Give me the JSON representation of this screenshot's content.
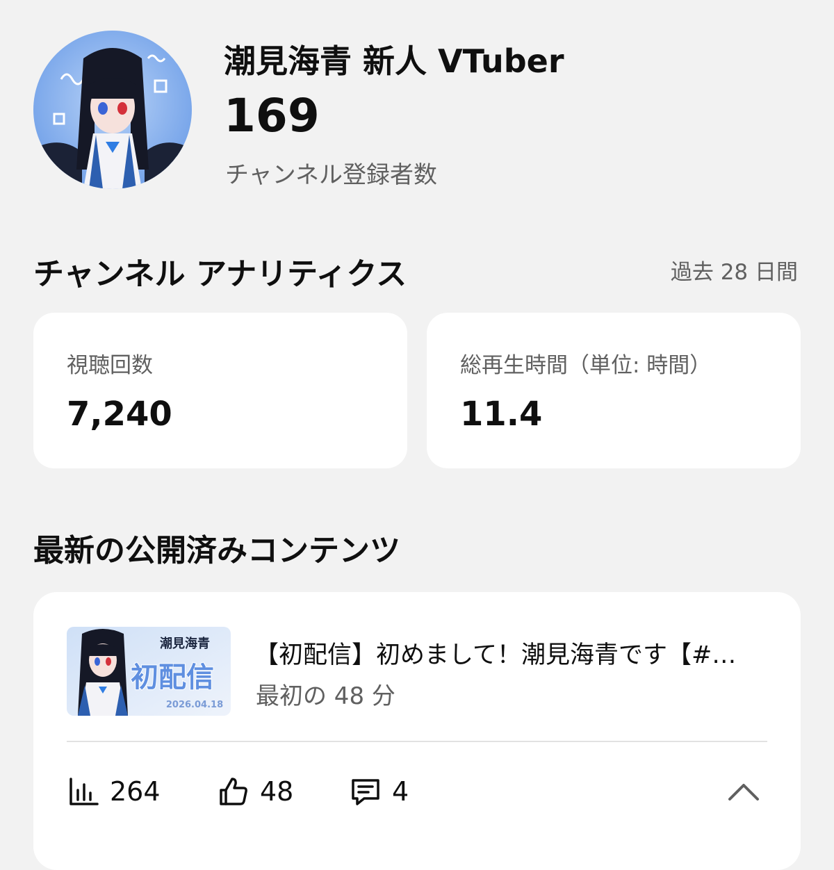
{
  "channel": {
    "name": "潮見海青 新人 VTuber",
    "subscriber_count": "169",
    "subscriber_label": "チャンネル登録者数"
  },
  "analytics": {
    "title": "チャンネル アナリティクス",
    "period": "過去 28 日間",
    "metrics": [
      {
        "label": "視聴回数",
        "value": "7,240"
      },
      {
        "label": "総再生時間（単位: 時間）",
        "value": "11.4"
      }
    ]
  },
  "latest": {
    "title": "最新の公開済みコンテンツ",
    "video": {
      "title": "【初配信】初めまして！潮見海青です【#…",
      "subtitle": "最初の 48 分",
      "thumbnail": {
        "logo_text": "潮見海青",
        "banner_text": "初配信",
        "date_text": "2026.04.18"
      },
      "stats": {
        "views": "264",
        "likes": "48",
        "comments": "4"
      }
    }
  },
  "icons": {
    "views": "bar-chart-icon",
    "likes": "thumb-up-icon",
    "comments": "comment-icon",
    "collapse": "chevron-up-icon"
  },
  "colors": {
    "background": "#f2f2f2",
    "card": "#ffffff",
    "text_primary": "#0f0f0f",
    "text_secondary": "#606060",
    "avatar_accent": "#7aa7ee"
  }
}
